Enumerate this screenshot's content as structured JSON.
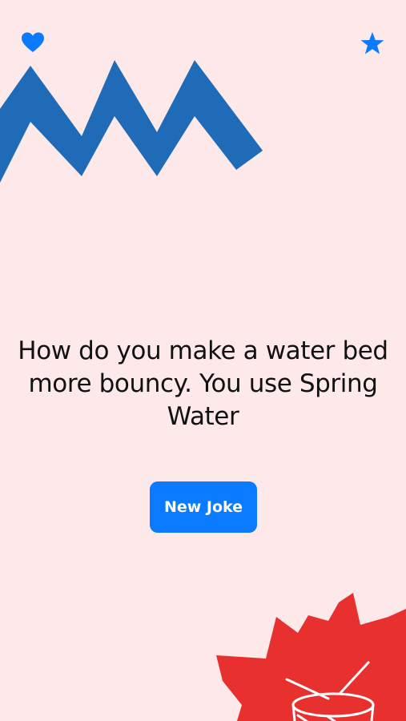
{
  "header": {
    "favorite_icon": "heart-icon",
    "rate_icon": "star-icon"
  },
  "joke": {
    "text": "How do you make a water bed more bouncy. You use Spring Water"
  },
  "actions": {
    "new_joke_label": "New Joke"
  },
  "colors": {
    "background": "#fde8ea",
    "accent": "#0a7aff",
    "zigzag": "#1f6bb8",
    "splat": "#e8302f",
    "text": "#111111"
  },
  "decorations": {
    "zigzag": "zigzag-decoration",
    "splat": "red-splat-decoration",
    "drum": "drum-icon"
  }
}
